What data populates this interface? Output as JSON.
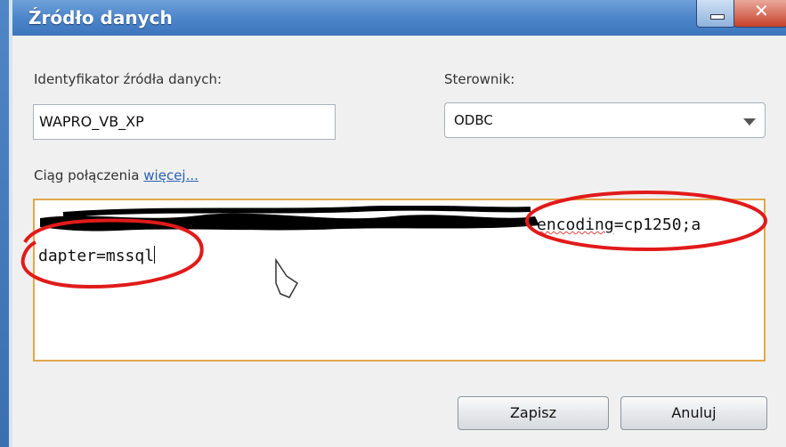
{
  "window": {
    "title": "Źródło danych",
    "minimize_glyph": "▬",
    "close_glyph": "✕"
  },
  "form": {
    "id_label": "Identyfikator źródła danych:",
    "id_value": "WAPRO_VB_XP",
    "driver_label": "Sterownik:",
    "driver_value": "ODBC",
    "conn_label": "Ciąg połączenia",
    "conn_more_link": "więcej...",
    "conn_visible_a": "encoding",
    "conn_visible_b": "=cp1250;a",
    "conn_visible_c": "dapter=mssql"
  },
  "buttons": {
    "save": "Zapisz",
    "cancel": "Anuluj"
  },
  "colors": {
    "annotation_red": "#e11a1a",
    "field_border_focus": "#e1a84a"
  }
}
